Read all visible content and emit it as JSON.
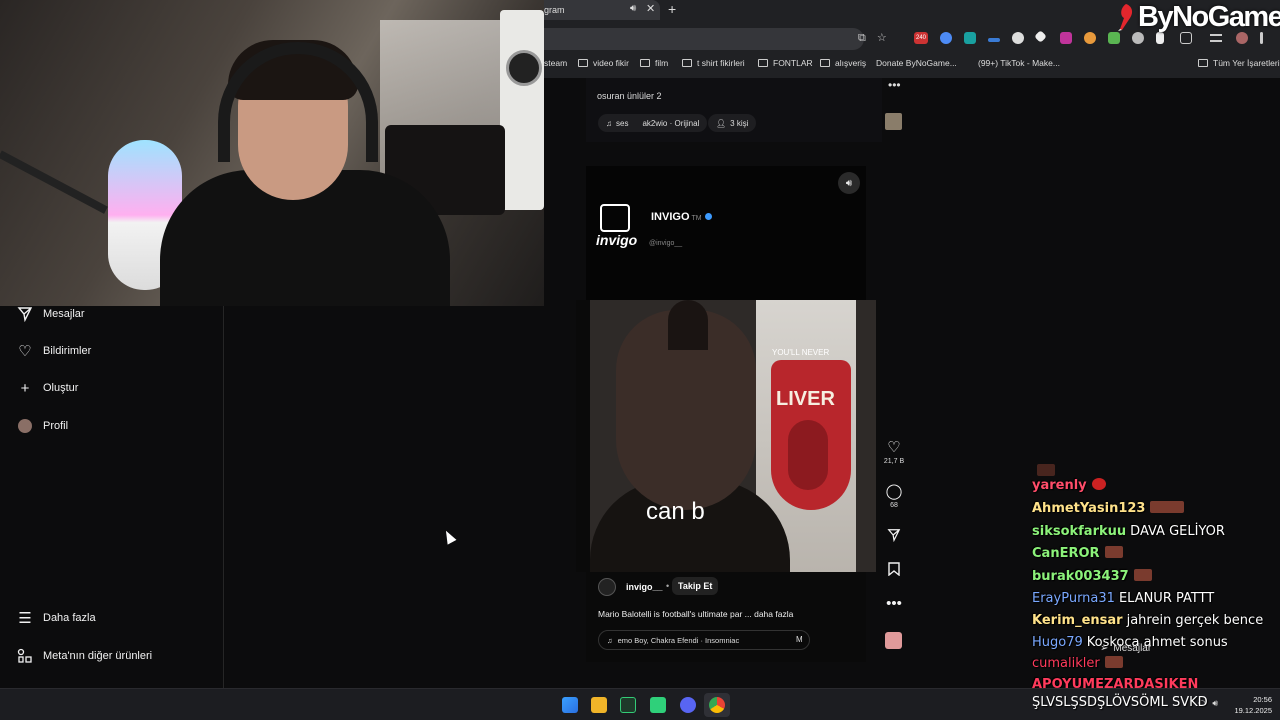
{
  "browser": {
    "tab_title": "gram",
    "tab_audio_icon": "speaker-icon",
    "tab_close": "✕",
    "new_tab": "+",
    "brand": "ByNoGame",
    "badge": "240",
    "bookmarks": [
      "steam",
      "video fikir",
      "film",
      "t shirt fikirleri",
      "FONTLAR",
      "alışveriş",
      "Donate ByNoGame...",
      "(99+) TikTok - Make..."
    ],
    "bookmarks_right": "Tüm Yer İşaretleri"
  },
  "sidebar": {
    "items": [
      {
        "label": "Mesajlar",
        "icon": "send-icon"
      },
      {
        "label": "Bildirimler",
        "icon": "heart-icon"
      },
      {
        "label": "Oluştur",
        "icon": "plus-icon"
      },
      {
        "label": "Profil",
        "icon": "avatar"
      }
    ],
    "bottom_items": [
      {
        "label": "Daha fazla",
        "icon": "menu-icon"
      },
      {
        "label": "Meta'nın diğer ürünleri",
        "icon": "meta-apps-icon"
      }
    ]
  },
  "previous_post": {
    "caption": "osuran ünlüler 2",
    "audio": "ses",
    "audio_source": "ak2wio · Orijinal",
    "people": "3 kişi"
  },
  "reel": {
    "account_display": "INVIGO",
    "account_tm": "TM",
    "logo_word": "invigo",
    "handle": "@invigo__",
    "caption_overlay": "can b",
    "username": "invigo__",
    "dot": "•",
    "follow": "Takip Et",
    "description": "Mario Balotelli is football's ultimate par ... daha fazla",
    "music": "emo Boy, Chakra Efendi · Insomniac",
    "music_more": "M",
    "crest_text": "LIVER",
    "crest_banner": "YOU'LL NEVER"
  },
  "actions": {
    "likes": "21,7 B",
    "comments": "68"
  },
  "chat": [
    {
      "user": "yarenly",
      "color": "#ff4d6a",
      "msg": "",
      "emote": "small"
    },
    {
      "user": "AhmetYasin123",
      "color": "#ffe28a",
      "msg": "",
      "emote": "wide"
    },
    {
      "user": "siksokfarkuu",
      "color": "#8cf27a",
      "msg": "DAVA GELİYOR",
      "emote": ""
    },
    {
      "user": "CanEROR",
      "color": "#8cf27a",
      "msg": "",
      "emote": "small"
    },
    {
      "user": "burak003437",
      "color": "#8cf27a",
      "msg": "",
      "emote": "small"
    },
    {
      "user": "ErayPurna31",
      "color": "#7aa8ff",
      "msg": "ELANUR PATTT",
      "emote": ""
    },
    {
      "user": "Kerim_ensar",
      "color": "#ffe28a",
      "msg": "jahrein gerçek bence",
      "emote": ""
    },
    {
      "user": "Hugo79",
      "color": "#7aa8ff",
      "msg": "Koskoca ahmet sonus",
      "emote": ""
    },
    {
      "user": "cumalikler",
      "color": "#ff3b5c",
      "msg": "",
      "emote": "small"
    },
    {
      "user": "APOYUMEZARDASIKEN",
      "color": "#ff3b5c",
      "msg": "",
      "emote": ""
    },
    {
      "user": "",
      "color": "#ffffff",
      "msg": "ŞLVSLŞSDŞLÖVSÖML SVKD",
      "emote": ""
    }
  ],
  "chat_popup": "Mesajlar",
  "taskbar": {
    "time": "20:56",
    "date": "19.12.2025"
  }
}
